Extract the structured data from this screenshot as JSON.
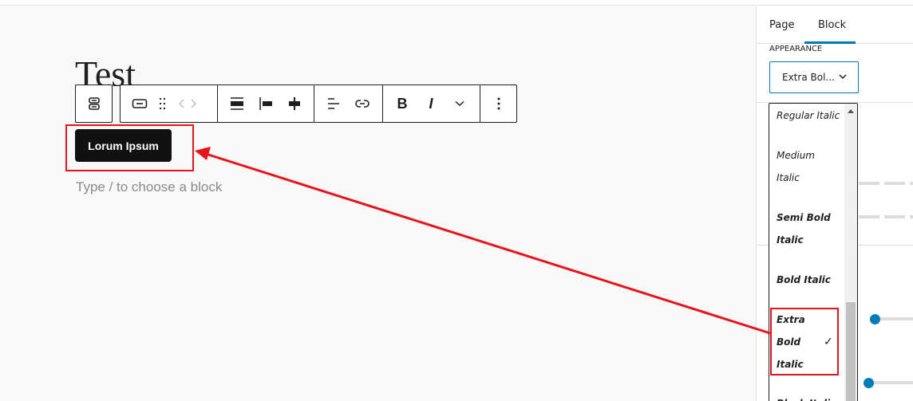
{
  "editor": {
    "title": "Test",
    "button_block_label": "Lorum Ipsum",
    "placeholder": "Type / to choose a block"
  },
  "toolbar": {
    "parent_icon": "buttons-parent-icon",
    "groups": [
      [
        "button-block-icon",
        "drag-handle-icon",
        "move-arrows-icon"
      ],
      [
        "justify-stretch-icon",
        "justify-left-icon",
        "justify-center-icon"
      ],
      [
        "text-align-icon",
        "link-icon"
      ],
      [
        "bold-icon",
        "italic-icon",
        "more-rich-text-chevron-icon"
      ],
      [
        "options-kebab-icon"
      ]
    ],
    "bold_label": "B",
    "italic_label": "I"
  },
  "sidebar": {
    "tabs": [
      {
        "label": "Page",
        "active": false
      },
      {
        "label": "Block",
        "active": true
      }
    ],
    "section_label": "APPEARANCE",
    "appearance_select_value": "Extra Bol...",
    "dropdown_options": [
      {
        "label": "Regular Italic",
        "weight": "normal",
        "selected": false
      },
      {
        "label": "Medium",
        "weight": "500",
        "selected": false
      },
      {
        "label": "Italic",
        "weight": "500",
        "selected": false
      },
      {
        "label": "Semi Bold",
        "weight": "600",
        "selected": false
      },
      {
        "label": "Italic",
        "weight": "600",
        "selected": false
      },
      {
        "label": "Bold Italic",
        "weight": "bold",
        "selected": false
      },
      {
        "label": "Extra",
        "weight": "800",
        "selected": true
      },
      {
        "label": "Bold",
        "weight": "800",
        "selected": true
      },
      {
        "label": "Italic",
        "weight": "800",
        "selected": true
      },
      {
        "label": "Black Italic",
        "weight": "900",
        "selected": false
      }
    ],
    "selected_check": "✓",
    "slider_values": [
      0,
      0
    ]
  },
  "colors": {
    "accent": "#007cba",
    "annotation_red": "#e8131b",
    "button_bg": "#111111"
  }
}
